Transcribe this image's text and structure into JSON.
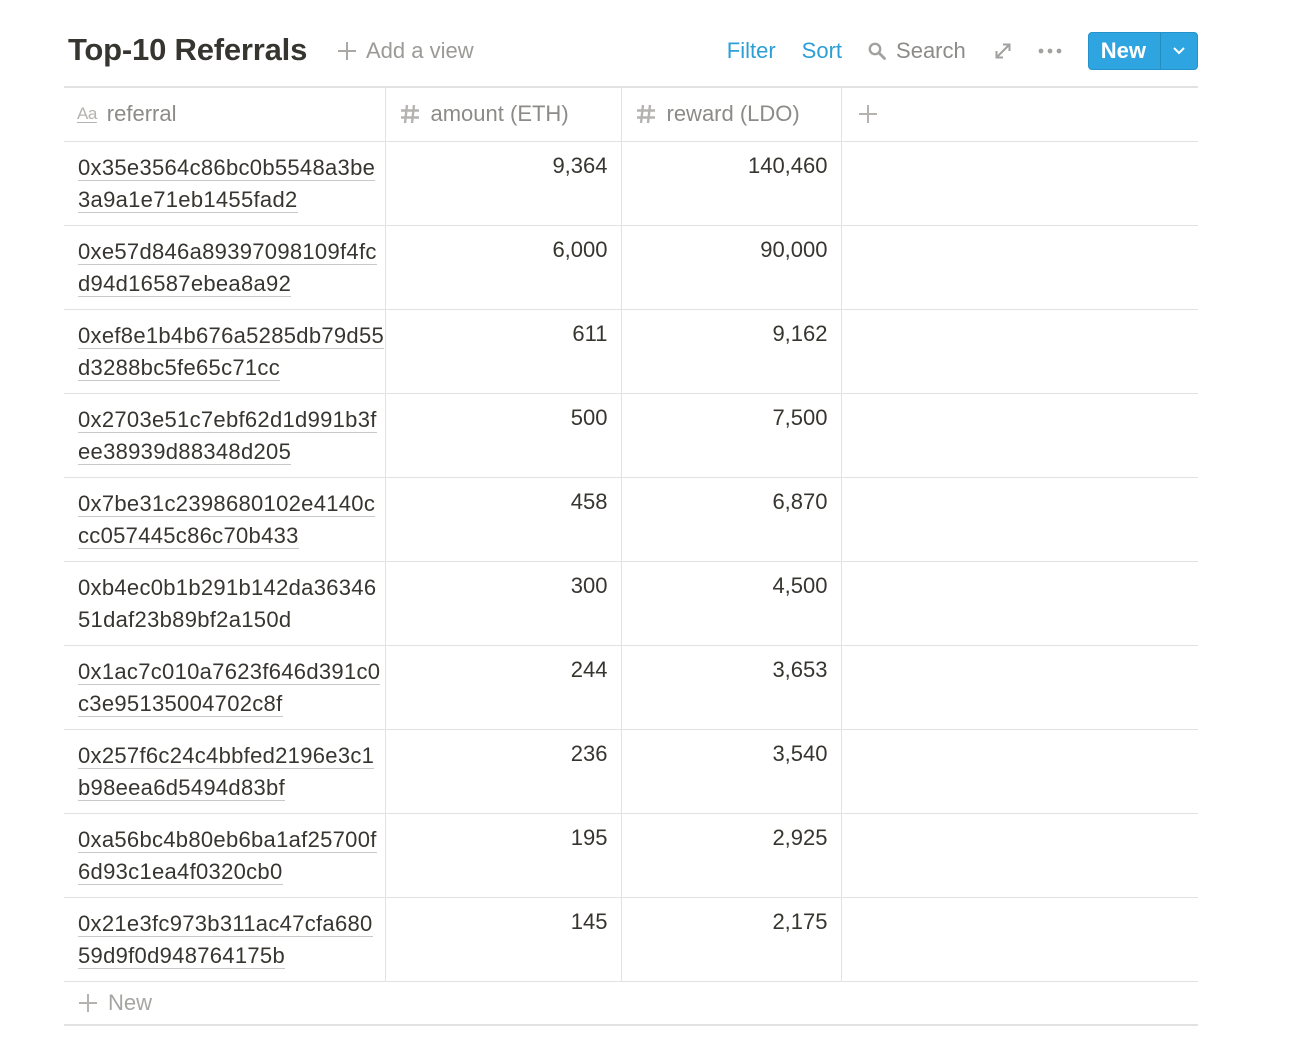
{
  "header": {
    "title": "Top-10 Referrals",
    "add_view_label": "Add a view"
  },
  "toolbar": {
    "filter_label": "Filter",
    "sort_label": "Sort",
    "search_label": "Search",
    "expand_icon": "expand-icon",
    "more_icon": "more-icon",
    "new_label": "New"
  },
  "table": {
    "columns": [
      {
        "label": "referral",
        "icon": "text-property-icon"
      },
      {
        "label": "amount (ETH)",
        "icon": "number-property-icon"
      },
      {
        "label": "reward (LDO)",
        "icon": "number-property-icon"
      }
    ],
    "rows": [
      {
        "referral": "0x35e3564c86bc0b5548a3be3a9a1e71eb1455fad2",
        "amount": "9,364",
        "reward": "140,460"
      },
      {
        "referral": "0xe57d846a89397098109f4fcd94d16587ebea8a92",
        "amount": "6,000",
        "reward": "90,000"
      },
      {
        "referral": "0xef8e1b4b676a5285db79d55d3288bc5fe65c71cc",
        "amount": "611",
        "reward": "9,162"
      },
      {
        "referral": "0x2703e51c7ebf62d1d991b3fee38939d88348d205",
        "amount": "500",
        "reward": "7,500"
      },
      {
        "referral": "0x7be31c2398680102e4140ccc057445c86c70b433",
        "amount": "458",
        "reward": "6,870"
      },
      {
        "referral": "0xb4ec0b1b291b142da3634651daf23b89bf2a150d",
        "amount": "300",
        "reward": "4,500"
      },
      {
        "referral": "0x1ac7c010a7623f646d391c0c3e95135004702c8f",
        "amount": "244",
        "reward": "3,653"
      },
      {
        "referral": "0x257f6c24c4bbfed2196e3c1b98eea6d5494d83bf",
        "amount": "236",
        "reward": "3,540"
      },
      {
        "referral": "0xa56bc4b80eb6ba1af25700f6d93c1ea4f0320cb0",
        "amount": "195",
        "reward": "2,925"
      },
      {
        "referral": "0x21e3fc973b311ac47cfa68059d9f0d948764175b",
        "amount": "145",
        "reward": "2,175"
      }
    ],
    "new_row_label": "New"
  },
  "colors": {
    "accent": "#2ea5e0",
    "link": "#2e9fd6",
    "text": "#37352f",
    "muted": "#8c8b88",
    "border": "#e2e2e0"
  }
}
